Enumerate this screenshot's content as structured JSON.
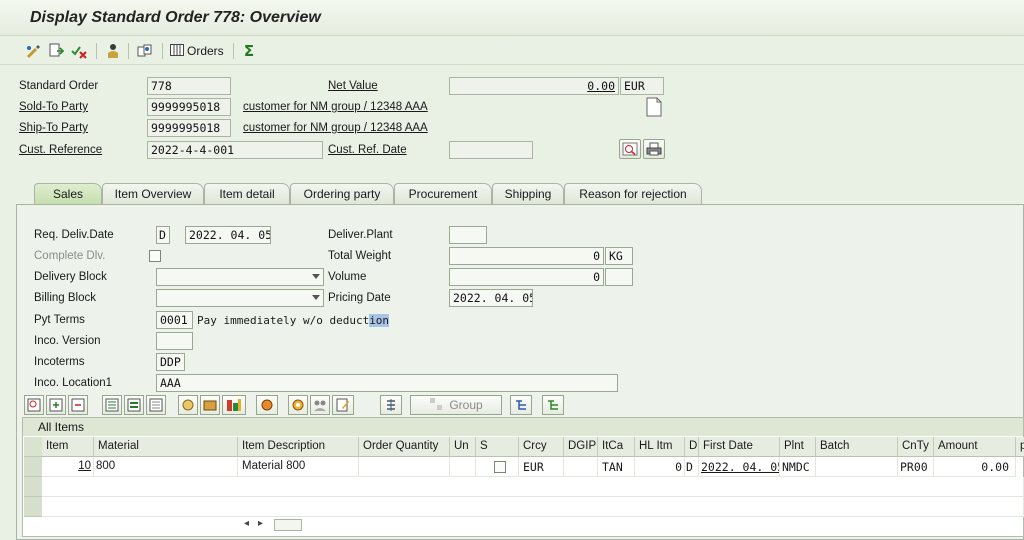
{
  "title": "Display Standard Order 778: Overview",
  "toolbar": {
    "orders_label": "Orders"
  },
  "header": {
    "standard_order_label": "Standard Order",
    "standard_order_value": "778",
    "net_value_label": "Net Value",
    "net_value_value": "0.00",
    "currency": "EUR",
    "sold_to_label": "Sold-To Party",
    "sold_to_value": "9999995018",
    "sold_to_desc": "customer for NM group / 12348 AAA",
    "ship_to_label": "Ship-To Party",
    "ship_to_value": "9999995018",
    "ship_to_desc": "customer for NM group / 12348 AAA",
    "cust_ref_label": "Cust. Reference",
    "cust_ref_value": "2022-4-4-001",
    "cust_ref_date_label": "Cust. Ref. Date",
    "cust_ref_date_value": ""
  },
  "tabs": [
    "Sales",
    "Item Overview",
    "Item detail",
    "Ordering party",
    "Procurement",
    "Shipping",
    "Reason for rejection"
  ],
  "sales": {
    "req_deliv_date_label": "Req. Deliv.Date",
    "req_deliv_date_type": "D",
    "req_deliv_date_value": "2022. 04. 05",
    "deliver_plant_label": "Deliver.Plant",
    "deliver_plant_value": "",
    "complete_dlv_label": "Complete Dlv.",
    "total_weight_label": "Total Weight",
    "total_weight_value": "0",
    "weight_unit": "KG",
    "delivery_block_label": "Delivery Block",
    "delivery_block_value": "",
    "volume_label": "Volume",
    "volume_value": "0",
    "volume_unit": "",
    "billing_block_label": "Billing Block",
    "billing_block_value": "",
    "pricing_date_label": "Pricing Date",
    "pricing_date_value": "2022. 04. 05",
    "pyt_terms_label": "Pyt Terms",
    "pyt_terms_value": "0001",
    "pyt_terms_desc_a": "Pay immediately w/o deduct",
    "pyt_terms_desc_b": "ion",
    "inco_version_label": "Inco. Version",
    "inco_version_value": "",
    "incoterms_label": "Incoterms",
    "incoterms_value": "DDP",
    "inco_location_label": "Inco. Location1",
    "inco_location_value": "AAA"
  },
  "grid_toolbar": {
    "group_label": "Group"
  },
  "items": {
    "caption": "All Items",
    "columns": [
      "Item",
      "Material",
      "Item Description",
      "Order Quantity",
      "Un",
      "S",
      "Crcy",
      "DGIP",
      "ItCa",
      "HL Itm",
      "D",
      "First Date",
      "Plnt",
      "Batch",
      "CnTy",
      "Amount",
      "p"
    ],
    "rows": [
      {
        "item": "10",
        "material": "800",
        "description": "Material 800",
        "quantity": "",
        "unit": "",
        "currency": "EUR",
        "dgip": "",
        "itca": "TAN",
        "hl_itm": "0",
        "d": "D",
        "first_date": "2022. 04. 05",
        "plant": "NMDC",
        "batch": "",
        "cnty": "PR00",
        "amount": "0.00"
      }
    ]
  },
  "colors": {
    "background": "#e9f0e4",
    "active_tab": "#c5dfae",
    "selection": "#a9c3e6"
  },
  "icons": [
    "change-display-icon",
    "other-document-icon",
    "delete-icon",
    "header-partner-icon",
    "document-flow-icon",
    "orders-table-icon",
    "sum-icon",
    "blank-page-icon",
    "print-preview-icon",
    "print-icon"
  ]
}
